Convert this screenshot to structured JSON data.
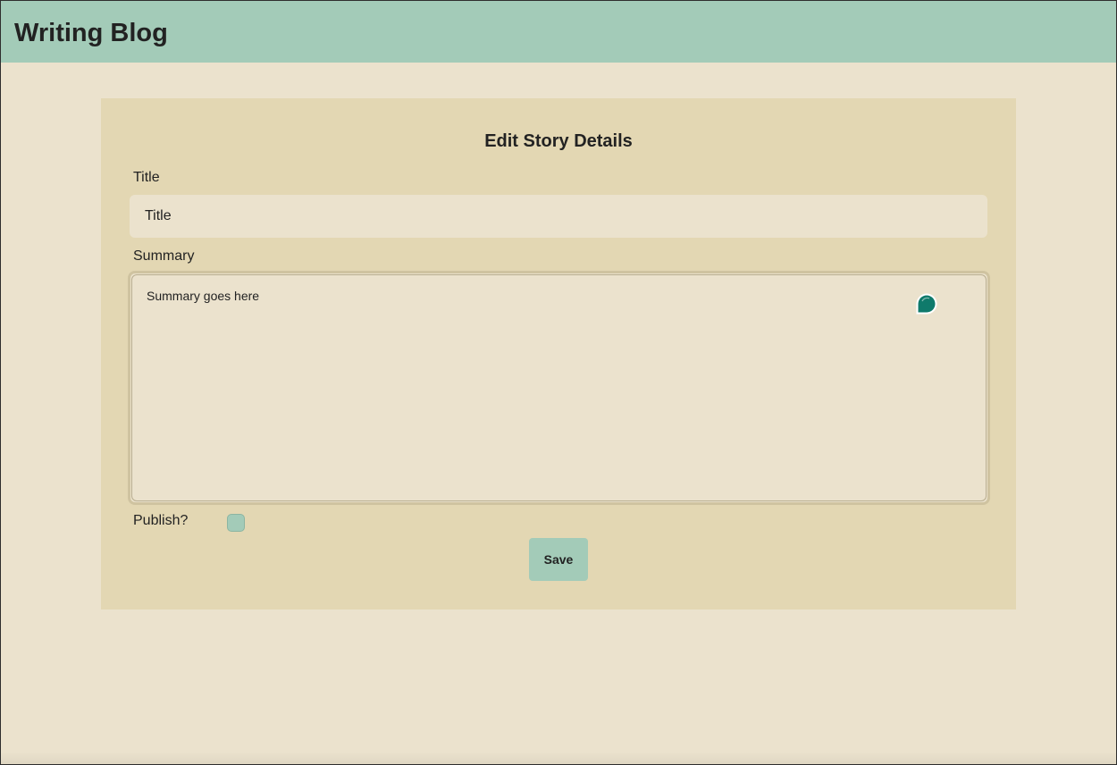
{
  "header": {
    "site_title": "Writing Blog"
  },
  "form": {
    "heading": "Edit Story Details",
    "title_label": "Title",
    "title_placeholder": "Title",
    "title_value": "",
    "summary_label": "Summary",
    "summary_value": "Summary goes here",
    "publish_label": "Publish?",
    "publish_checked": false,
    "save_label": "Save"
  },
  "icons": {
    "assist": "chat-bubble-icon"
  },
  "colors": {
    "header_bg": "#a3cbb8",
    "page_bg": "#ebe2cd",
    "card_bg": "#e3d7b3",
    "accent": "#a3cbb8",
    "assist_icon": "#0f7a6b"
  }
}
